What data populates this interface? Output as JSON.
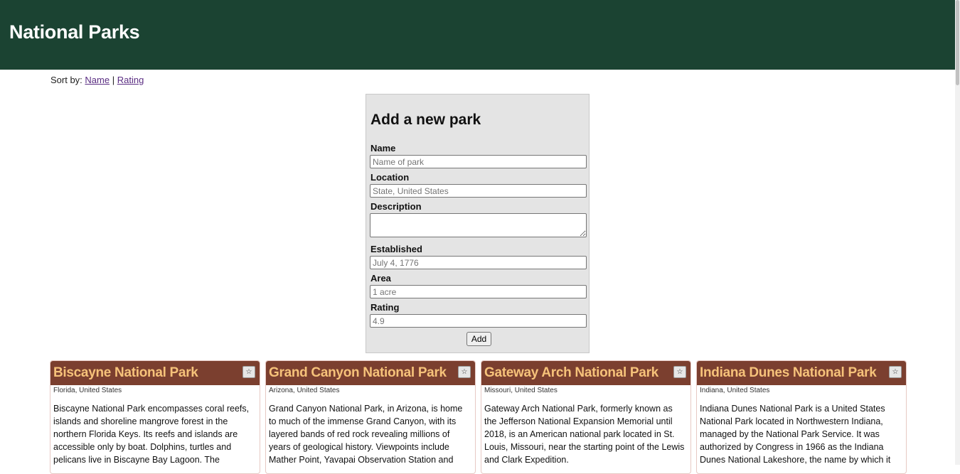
{
  "header": {
    "title": "National Parks"
  },
  "sort": {
    "prefix": "Sort by:",
    "name_link": "Name",
    "separator": "|",
    "rating_link": "Rating"
  },
  "form": {
    "title": "Add a new park",
    "name": {
      "label": "Name",
      "placeholder": "Name of park"
    },
    "location": {
      "label": "Location",
      "placeholder": "State, United States"
    },
    "description": {
      "label": "Description"
    },
    "established": {
      "label": "Established",
      "placeholder": "July 4, 1776"
    },
    "area": {
      "label": "Area",
      "placeholder": "1 acre"
    },
    "rating": {
      "label": "Rating",
      "placeholder": "4.9"
    },
    "submit_label": "Add"
  },
  "parks": [
    {
      "name": "Biscayne National Park",
      "location": "Florida, United States",
      "description": "Biscayne National Park encompasses coral reefs, islands and shoreline mangrove forest in the northern Florida Keys. Its reefs and islands are accessible only by boat. Dolphins, turtles and pelicans live in Biscayne Bay Lagoon. The",
      "star": "☆"
    },
    {
      "name": "Grand Canyon National Park",
      "location": "Arizona, United States",
      "description": "Grand Canyon National Park, in Arizona, is home to much of the immense Grand Canyon, with its layered bands of red rock revealing millions of years of geological history. Viewpoints include Mather Point, Yavapai Observation Station and",
      "star": "☆"
    },
    {
      "name": "Gateway Arch National Park",
      "location": "Missouri, United States",
      "description": "Gateway Arch National Park, formerly known as the Jefferson National Expansion Memorial until 2018, is an American national park located in St. Louis, Missouri, near the starting point of the Lewis and Clark Expedition.",
      "star": "☆"
    },
    {
      "name": "Indiana Dunes National Park",
      "location": "Indiana, United States",
      "description": "Indiana Dunes National Park is a United States National Park located in Northwestern Indiana, managed by the National Park Service. It was authorized by Congress in 1966 as the Indiana Dunes National Lakeshore, the name by which it",
      "star": "☆"
    }
  ]
}
